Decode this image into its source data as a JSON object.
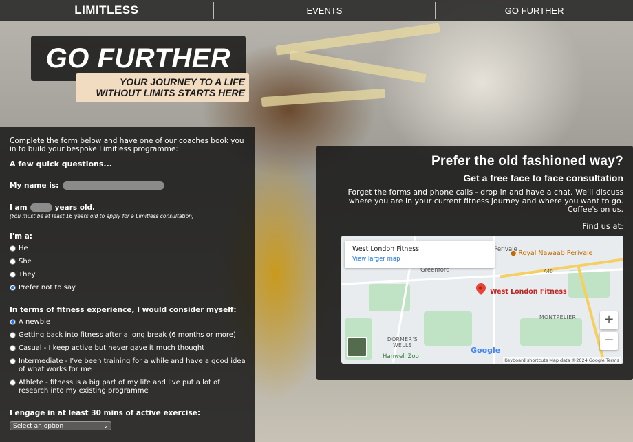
{
  "nav": {
    "logo": "LIMITLESS",
    "links": [
      "EVENTS",
      "GO FURTHER"
    ]
  },
  "hero": {
    "title": "GO FURTHER",
    "subtitle_line1": "YOUR JOURNEY TO A LIFE",
    "subtitle_line2": "WITHOUT LIMITS STARTS HERE"
  },
  "form": {
    "intro": "Complete the form below and have one of our coaches book you in to build your bespoke Limitless programme:",
    "heading": "A few quick questions...",
    "name_label": "My name is:",
    "name_value": "",
    "age_prefix": "I am",
    "age_value": "",
    "age_suffix": "years old.",
    "age_note": "(You must be at least 16 years old to apply for a Limitless consultation)",
    "gender_label": "I'm a:",
    "gender_options": [
      "He",
      "She",
      "They",
      "Prefer not to say"
    ],
    "gender_selected": "Prefer not to say",
    "experience_label": "In terms of fitness experience, I would consider myself:",
    "experience_options": [
      "A newbie",
      "Getting back into fitness after a long break (6 months or more)",
      "Casual - I keep active but never gave it much thought",
      "Intermediate - I've been training for a while and have a good idea of what works for me",
      "Athlete - fitness is a big part of my life and I've put a lot of research into my existing programme"
    ],
    "experience_selected": "A newbie",
    "exercise_label": "I engage in at least 30 mins of active exercise:",
    "exercise_select_value": "Select an option"
  },
  "right": {
    "title": "Prefer the old fashioned way?",
    "subtitle": "Get a free face to face consultation",
    "body_line1": "Forget the forms and phone calls - drop in and have a chat. We'll discuss",
    "body_line2": "where you are in your current fitness journey and where you want to go.",
    "body_line3": "Coffee's on us.",
    "find_us": "Find us at:"
  },
  "map": {
    "place_name": "West London Fitness",
    "larger_map_link": "View larger map",
    "pin_label": "West London Fitness",
    "poi": "Royal Nawaab Perivale",
    "labels": {
      "greenford": "Greenford",
      "perivale": "Perivale",
      "montpelier": "MONTPELIER",
      "dormers_wells": "DORMER'S WELLS",
      "hanwell_zoo": "Hanwell Zoo",
      "a40": "A40",
      "google": "Google",
      "attribution": "Keyboard shortcuts   Map data ©2024 Google   Terms"
    },
    "zoom_in": "+",
    "zoom_out": "−"
  }
}
